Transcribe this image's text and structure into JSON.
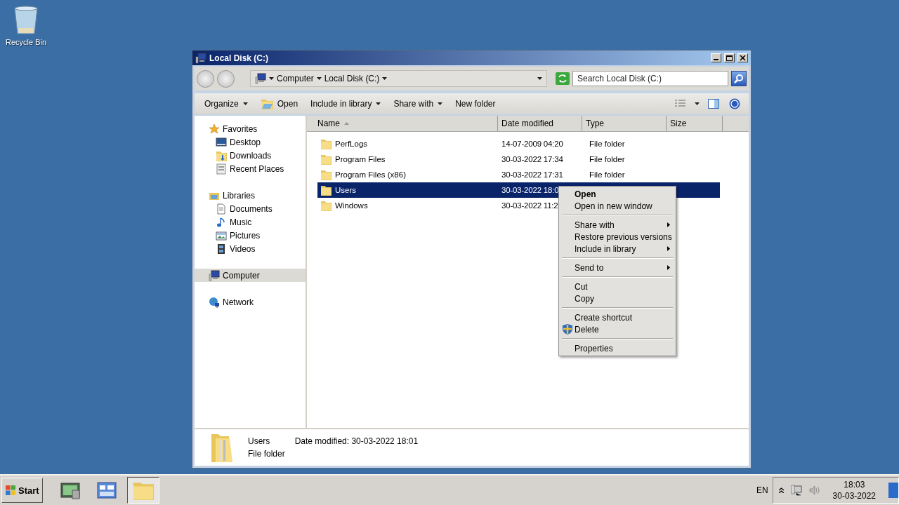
{
  "desktop": {
    "icons": [
      {
        "label": "Recycle Bin"
      }
    ]
  },
  "window": {
    "title": "Local Disk (C:)"
  },
  "address_bar": {
    "crumbs": [
      "Computer",
      "Local Disk (C:)"
    ]
  },
  "search": {
    "placeholder": "Search Local Disk (C:)"
  },
  "toolbar": {
    "items": [
      {
        "label": "Organize",
        "kind": "menu"
      },
      {
        "label": "Open",
        "kind": "icon"
      },
      {
        "label": "Include in library",
        "kind": "menu"
      },
      {
        "label": "Share with",
        "kind": "menu"
      },
      {
        "label": "New folder",
        "kind": "plain"
      }
    ]
  },
  "sidebar": {
    "groups": [
      {
        "label": "Favorites",
        "selected": false,
        "children": [
          {
            "label": "Desktop",
            "selected": false
          },
          {
            "label": "Downloads",
            "selected": false
          },
          {
            "label": "Recent Places",
            "selected": false
          }
        ]
      },
      {
        "label": "Libraries",
        "selected": false,
        "children": [
          {
            "label": "Documents",
            "selected": false
          },
          {
            "label": "Music",
            "selected": false
          },
          {
            "label": "Pictures",
            "selected": false
          },
          {
            "label": "Videos",
            "selected": false
          }
        ]
      },
      {
        "label": "Computer",
        "selected": true
      },
      {
        "label": "Network",
        "selected": false
      }
    ]
  },
  "table": {
    "columns": [
      {
        "label": "Name",
        "sorted": true
      },
      {
        "label": "Date modified",
        "sorted": false
      },
      {
        "label": "Type",
        "sorted": false
      },
      {
        "label": "Size",
        "sorted": false
      }
    ],
    "rows": [
      {
        "name": "PerfLogs",
        "date": "14-07-2009 04:20",
        "type": "File folder",
        "selected": false
      },
      {
        "name": "Program Files",
        "date": "30-03-2022 17:34",
        "type": "File folder",
        "selected": false
      },
      {
        "name": "Program Files (x86)",
        "date": "30-03-2022 17:31",
        "type": "File folder",
        "selected": false
      },
      {
        "name": "Users",
        "date": "30-03-2022 18:0",
        "selected": true
      },
      {
        "name": "Windows",
        "date": "30-03-2022 11:2",
        "selected": false
      }
    ]
  },
  "context_menu": {
    "groups": [
      [
        {
          "label": "Open",
          "kind": "plain",
          "default": true,
          "submenu": false
        },
        {
          "label": "Open in new window",
          "kind": "plain",
          "default": false,
          "submenu": false
        }
      ],
      [
        {
          "label": "Share with",
          "kind": "plain",
          "default": false,
          "submenu": true
        },
        {
          "label": "Restore previous versions",
          "kind": "plain",
          "default": false,
          "submenu": false
        },
        {
          "label": "Include in library",
          "kind": "plain",
          "default": false,
          "submenu": true
        }
      ],
      [
        {
          "label": "Send to",
          "kind": "plain",
          "default": false,
          "submenu": true
        }
      ],
      [
        {
          "label": "Cut",
          "kind": "plain",
          "default": false,
          "submenu": false
        },
        {
          "label": "Copy",
          "kind": "plain",
          "default": false,
          "submenu": false
        }
      ],
      [
        {
          "label": "Create shortcut",
          "kind": "plain",
          "default": false,
          "submenu": false
        },
        {
          "label": "Delete",
          "kind": "shield",
          "default": false,
          "submenu": false
        }
      ],
      [
        {
          "label": "Properties",
          "kind": "plain",
          "default": false,
          "submenu": false
        }
      ]
    ]
  },
  "details_pane": {
    "name": "Users",
    "date_label": "Date modified:",
    "date": "30-03-2022 18:01",
    "type": "File folder"
  },
  "taskbar": {
    "start": "Start",
    "buttons": [
      {
        "selected": false
      },
      {
        "selected": false
      },
      {
        "selected": true
      }
    ],
    "language": "EN",
    "time": "18:03",
    "date": "30-03-2022"
  }
}
